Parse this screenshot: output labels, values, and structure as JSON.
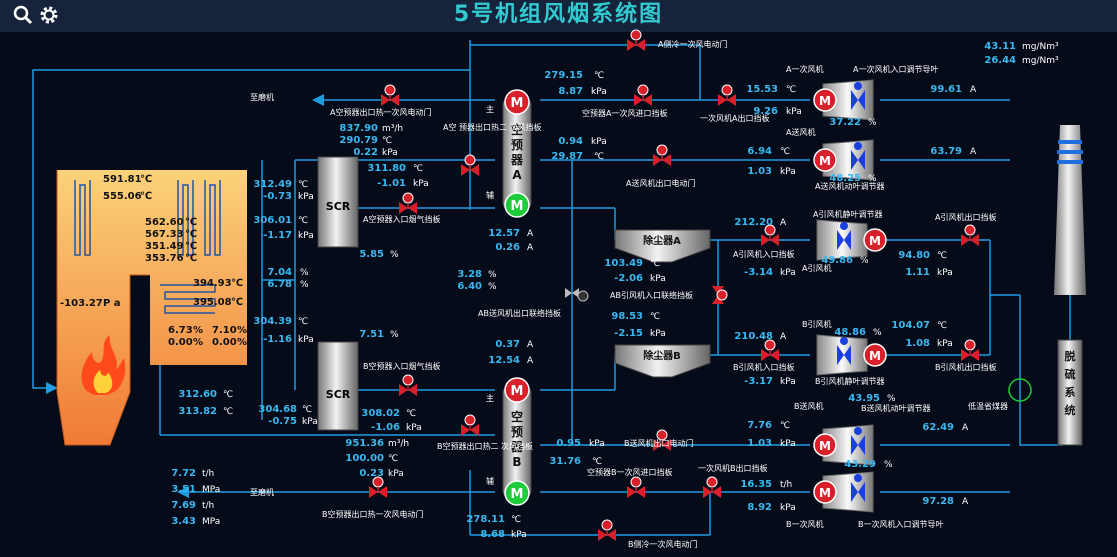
{
  "title": "5号机组风烟系统图",
  "colors": {
    "background": "#050b18",
    "pipe": "#1f9be0",
    "value": "#39b8f0",
    "valve": "#d8202a",
    "motor_running": "#1ecc3c",
    "boiler": "#f3a045"
  },
  "toolbar": {
    "search_icon": "search-icon",
    "settings_icon": "gear-icon"
  },
  "emissions": {
    "v1": "43.11",
    "u1": "mg/Nm³",
    "v2": "26.44",
    "u2": "mg/Nm³"
  },
  "labels": {
    "to_mill_top": "至磨机",
    "to_mill_bottom": "至磨机",
    "a_hot_damper": "A空预器出口热一次风电动门",
    "a_cold_damper": "A侧冷一次风电动门",
    "a_preheater_in_damper": "空预器A一次风进口挡板",
    "a_pa_out_damper": "一次风机A出口挡板",
    "a_pa_fan": "A一次风机",
    "a_pa_inlet_damper": "A一次风机入口调节导叶",
    "a_sa_fan": "A送风机",
    "a_sa_out_damper": "A送风机出口电动门",
    "a_sa_blade": "A送风机动叶调节器",
    "a_fluegas_damper": "A空预器入口烟气挡板",
    "a_preheater_outlet_hot": "A空 预器出口热二 次风挡板",
    "esp_a": "除尘器A",
    "esp_b": "除尘器B",
    "a_id_fan": "A引风机",
    "a_id_inlet_damper": "A引风机入口挡板",
    "a_id_blade": "A引风机静叶调节器",
    "a_id_out_damper": "A引风机出口挡板",
    "ab_id_tie": "AB引风机入口联络挡板",
    "ab_sa_tie": "AB送风机出口联络挡板",
    "b_id_fan": "B引风机",
    "b_id_inlet_damper": "B引风机入口挡板",
    "b_id_blade": "B引风机静叶调节器",
    "b_id_out_damper": "B引风机出口挡板",
    "b_fluegas_damper": "B空预器入口烟气挡板",
    "b_preheater_outlet_hot": "B空预器出口热二 次风挡板",
    "b_sa_fan": "B送风机",
    "b_sa_blade": "B送风机动叶调节器",
    "b_sa_out_damper": "B送风机出口电动门",
    "b_preheater_in_damper": "空预器B一次风进口挡板",
    "b_pa_out_damper": "一次风机B出口挡板",
    "b_pa_fan": "B一次风机",
    "b_pa_inlet_damper": "B一次风机入口调节导叶",
    "b_hot_damper": "B空预器出口热一次风电动门",
    "b_cold_damper": "B侧冷一次风电动门",
    "low_temp_econ": "低温省煤器",
    "desulf": "脱硫系统",
    "main": "主",
    "aux": "辅",
    "scr": "SCR",
    "ph_a_chars": [
      "空",
      "预",
      "器",
      "A"
    ],
    "ph_b_chars": [
      "空",
      "预",
      "器",
      "B"
    ],
    "motor_m": "M"
  },
  "boiler": {
    "t1": "591.81",
    "t1u": "℃",
    "t2": "555.06",
    "t2u": "℃",
    "t3": "562.60",
    "t4": "567.33",
    "t5": "351.49",
    "t6": "353.76",
    "tu": "℃",
    "t7": "394.93",
    "t8": "395.08",
    "o1": "6.73",
    "o2": "0.00",
    "o3": "7.10",
    "o4": "0.00",
    "pu": "%",
    "furnace_p": "-103.27",
    "furnace_pu": "P a"
  },
  "values": {
    "a_hot_flow": "837.90",
    "a_hot_flow_u": "m³/h",
    "a_hot_temp": "290.79",
    "a_hot_press": "0.22",
    "a_scr_temp": "311.80",
    "a_scr_press": "-1.01",
    "a_sa_hot_temp": "312.49",
    "a_sa_hot_press": "-0.73",
    "a_scr_in_temp": "306.01",
    "a_scr_in_press": "-1.17",
    "a_nox1": "5.85",
    "o2_a1": "7.04",
    "o2_a2": "6.78",
    "b_scr_in_temp": "304.39",
    "b_scr_in_press": "-1.16",
    "b_nox1": "7.51",
    "b_scr_out_temp": "304.68",
    "b_scr_out_press": "-0.75",
    "b_scr_temp": "308.02",
    "b_scr_press": "-1.06",
    "b_hot_flow": "951.36",
    "b_hot_temp": "100.00",
    "b_hot_press": "0.23",
    "ph_a_temp": "279.15",
    "ph_a_press": "8.87",
    "ph_a_sa_press": "0.94",
    "ph_a_sa_temp": "29.87",
    "ph_a_curr1": "12.57",
    "ph_a_curr2": "0.26",
    "ph_o2_1": "3.28",
    "ph_o2_2": "6.40",
    "ph_b_curr1": "0.37",
    "ph_b_curr2": "12.54",
    "ph_b_sa_press": "0.95",
    "ph_b_sa_temp": "31.76",
    "ph_b_temp": "278.11",
    "ph_b_press": "8.68",
    "boiler_t1": "312.60",
    "boiler_t2": "313.82",
    "coal1": "7.72",
    "coal1u": "t/h",
    "coal2": "3.51",
    "coal2u": "MPa",
    "coal3": "7.69",
    "coal3u": "t/h",
    "coal4": "3.43",
    "coal4u": "MPa",
    "a_pa_temp": "15.53",
    "a_pa_curr": "9.26",
    "a_pa_pos": "37.22",
    "a_pa_amp": "99.61",
    "a_sa_temp": "6.94",
    "a_sa_press": "1.03",
    "a_sa_pos": "48.25",
    "a_sa_amp": "63.79",
    "esp_a_temp": "103.49",
    "esp_a_press": "-2.06",
    "a_id_curr": "212.20",
    "a_id_press": "-3.14",
    "a_id_pos": "49.86",
    "a_id_out_temp": "94.80",
    "a_id_out_press": "1.11",
    "esp_b_temp": "98.53",
    "esp_b_press": "-2.15",
    "b_id_curr": "210.48",
    "b_id_press": "-3.17",
    "b_id_pos": "48.86",
    "b_id_out_temp": "104.07",
    "b_id_out_press": "1.08",
    "b_sa_pos": "43.95",
    "b_sa_temp": "7.76",
    "b_sa_press": "1.03",
    "b_sa_amp": "62.49",
    "b_pa_pos": "43.29",
    "b_pa_flow": "16.35",
    "b_pa_flow_u": "t/h",
    "b_pa_press": "8.92",
    "b_pa_amp": "97.28"
  },
  "units": {
    "c": "℃",
    "kpa": "kPa",
    "pct": "%",
    "a": "A",
    "m3h": "m³/h"
  }
}
